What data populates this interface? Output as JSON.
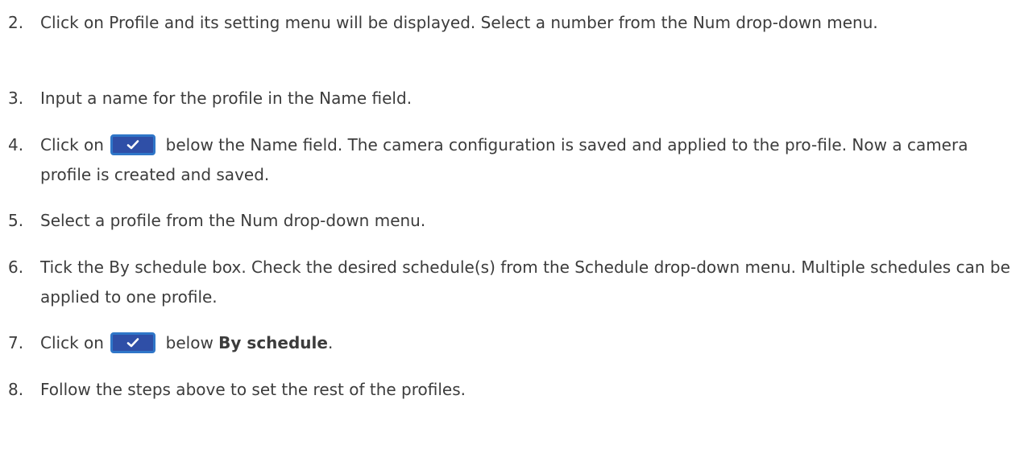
{
  "steps": [
    {
      "num": "2.",
      "text": "Click on Profile and its setting menu will be displayed. Select a number from the Num drop-down menu."
    },
    {
      "num": "3.",
      "text": "Input a name for the profile in the Name field."
    },
    {
      "num": "4.",
      "text_before": "Click on",
      "text_after": "below the Name field. The camera configuration is saved and applied to the pro-file. Now a camera profile is created and saved."
    },
    {
      "num": "5.",
      "text": "Select a profile from the Num drop-down menu."
    },
    {
      "num": "6.",
      "text": "Tick the By schedule box. Check the desired schedule(s) from the Schedule drop-down menu. Multiple schedules can be applied to one profile."
    },
    {
      "num": "7.",
      "text_before": "Click on",
      "text_middle": "below",
      "text_bold": "By schedule",
      "text_after": "."
    },
    {
      "num": "8.",
      "text": "Follow the steps above to set the rest of the profiles."
    }
  ],
  "icons": {
    "confirm_button": "checkmark-icon",
    "button_fill": "#2f4fa7",
    "button_border": "#2f76c8",
    "check_color": "#ffffff"
  }
}
